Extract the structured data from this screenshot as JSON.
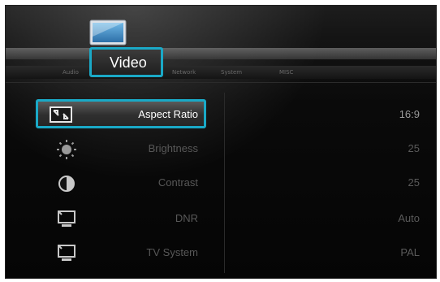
{
  "header": {
    "selected_tab": "Video",
    "tabs": [
      {
        "label": "Audio"
      },
      {
        "label": "Network"
      },
      {
        "label": "System"
      },
      {
        "label": "MISC"
      }
    ]
  },
  "menu": {
    "items": [
      {
        "label": "Aspect Ratio",
        "value": "16:9",
        "icon": "aspect-ratio-icon"
      },
      {
        "label": "Brightness",
        "value": "25",
        "icon": "brightness-icon"
      },
      {
        "label": "Contrast",
        "value": "25",
        "icon": "contrast-icon"
      },
      {
        "label": "DNR",
        "value": "Auto",
        "icon": "monitor-icon"
      },
      {
        "label": "TV System",
        "value": "PAL",
        "icon": "monitor-icon"
      }
    ]
  },
  "colors": {
    "accent": "#1aa9c7",
    "background": "#0a0a0a",
    "selected_text": "#ffffff",
    "dim_text": "#585858"
  }
}
